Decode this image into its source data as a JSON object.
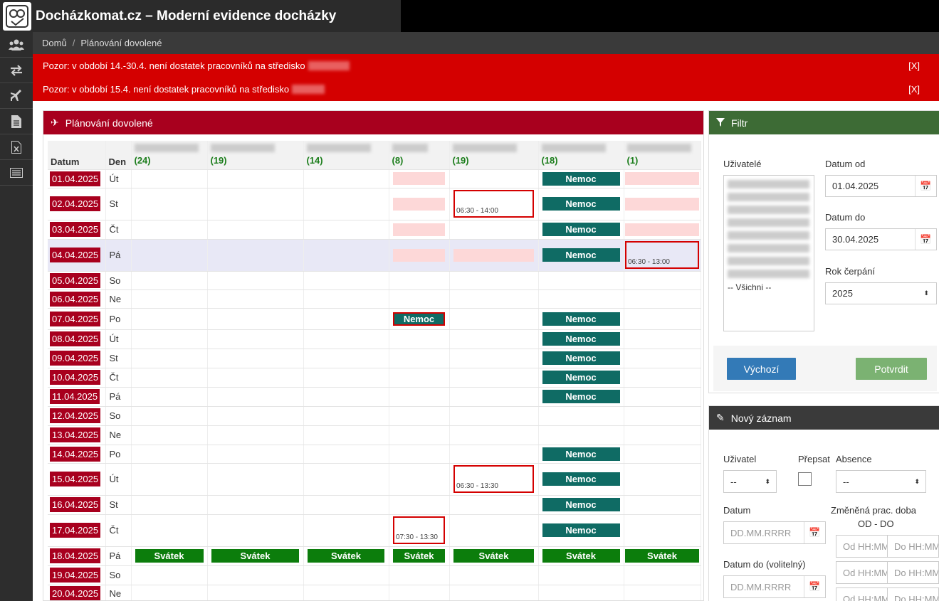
{
  "app": {
    "title": "Docházkomat.cz – Moderní evidence docházky"
  },
  "breadcrumb": {
    "home": "Domů",
    "current": "Plánování dovolené"
  },
  "alerts": [
    {
      "text": "Pozor: v období 14.-30.4. není dostatek pracovníků na středisko",
      "close": "[X]"
    },
    {
      "text": "Pozor: v období 15.4. není dostatek pracovníků na středisko",
      "close": "[X]"
    }
  ],
  "planner": {
    "title": "Plánování dovolené",
    "col_date": "Datum",
    "col_day": "Den",
    "user_counts": [
      "(24)",
      "(19)",
      "(14)",
      "(8)",
      "(19)",
      "(18)",
      "(1)"
    ],
    "nemoc": "Nemoc",
    "svatek": "Svátek",
    "rows": [
      {
        "date": "01.04.2025",
        "day": "Út"
      },
      {
        "date": "02.04.2025",
        "day": "St"
      },
      {
        "date": "03.04.2025",
        "day": "Čt"
      },
      {
        "date": "04.04.2025",
        "day": "Pá"
      },
      {
        "date": "05.04.2025",
        "day": "So"
      },
      {
        "date": "06.04.2025",
        "day": "Ne"
      },
      {
        "date": "07.04.2025",
        "day": "Po"
      },
      {
        "date": "08.04.2025",
        "day": "Út"
      },
      {
        "date": "09.04.2025",
        "day": "St"
      },
      {
        "date": "10.04.2025",
        "day": "Čt"
      },
      {
        "date": "11.04.2025",
        "day": "Pá"
      },
      {
        "date": "12.04.2025",
        "day": "So"
      },
      {
        "date": "13.04.2025",
        "day": "Ne"
      },
      {
        "date": "14.04.2025",
        "day": "Po"
      },
      {
        "date": "15.04.2025",
        "day": "Út"
      },
      {
        "date": "16.04.2025",
        "day": "St"
      },
      {
        "date": "17.04.2025",
        "day": "Čt"
      },
      {
        "date": "18.04.2025",
        "day": "Pá"
      },
      {
        "date": "19.04.2025",
        "day": "So"
      },
      {
        "date": "20.04.2025",
        "day": "Ne"
      }
    ],
    "times": {
      "r2c4": "06:30 - 14:00",
      "r4c6": "06:30 - 13:00",
      "r15c4": "06:30 - 13:30",
      "r17c3": "07:30 - 13:30"
    }
  },
  "filter": {
    "title": "Filtr",
    "users_label": "Uživatelé",
    "all_option": "-- Všichni --",
    "date_from_label": "Datum od",
    "date_from": "01.04.2025",
    "date_to_label": "Datum do",
    "date_to": "30.04.2025",
    "year_label": "Rok čerpání",
    "year": "2025",
    "reset_button": "Výchozí",
    "confirm_button": "Potvrdit"
  },
  "new_record": {
    "title": "Nový záznam",
    "user_label": "Uživatel",
    "user_value": "--",
    "overwrite_label": "Přepsat",
    "absence_label": "Absence",
    "absence_value": "--",
    "date_label": "Datum",
    "date_placeholder": "DD.MM.RRRR",
    "date_to_label": "Datum do (volitelný)",
    "changed_hours_label": "Změněná prac. doba",
    "changed_hours_sub": "OD - DO",
    "from_placeholder": "Od HH:MM",
    "to_placeholder": "Do HH:MM"
  }
}
